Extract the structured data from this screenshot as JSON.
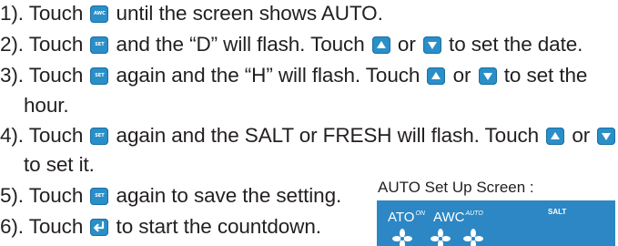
{
  "steps": [
    {
      "pre": "1). Touch ",
      "post": " until the screen shows AUTO."
    },
    {
      "pre": "2). Touch ",
      "mid1": " and the “D” will flash. Touch ",
      "mid2": " or ",
      "post": " to set the date."
    },
    {
      "pre": "3). Touch ",
      "mid1": " again and the “H” will flash. Touch ",
      "mid2": " or ",
      "post": " to set the"
    },
    {
      "cont": "hour."
    },
    {
      "pre": "4). Touch ",
      "mid1": " again and the SALT or FRESH will flash. Touch ",
      "mid2": " or "
    },
    {
      "cont": "to set it."
    },
    {
      "pre": "5). Touch ",
      "post": " again to save the setting."
    },
    {
      "pre": "6). Touch ",
      "post": " to start the countdown."
    }
  ],
  "buttons": {
    "awc": "AWC",
    "set": "SET"
  },
  "icons": {
    "awc_button": "awc-button-icon",
    "set_button": "set-button-icon",
    "up_button": "up-arrow-button-icon",
    "down_button": "down-arrow-button-icon",
    "enter_button": "enter-button-icon",
    "fan": "fan-icon"
  },
  "screen": {
    "title": "AUTO Set Up Screen :",
    "ato_label": "ATO",
    "ato_sup": "ON",
    "awc_label": "AWC",
    "awc_sup": "AUTO",
    "salt": "SALT"
  },
  "colors": {
    "button_blue": "#2a8fc8",
    "screen_blue": "#2c87c4",
    "text": "#231f20"
  }
}
